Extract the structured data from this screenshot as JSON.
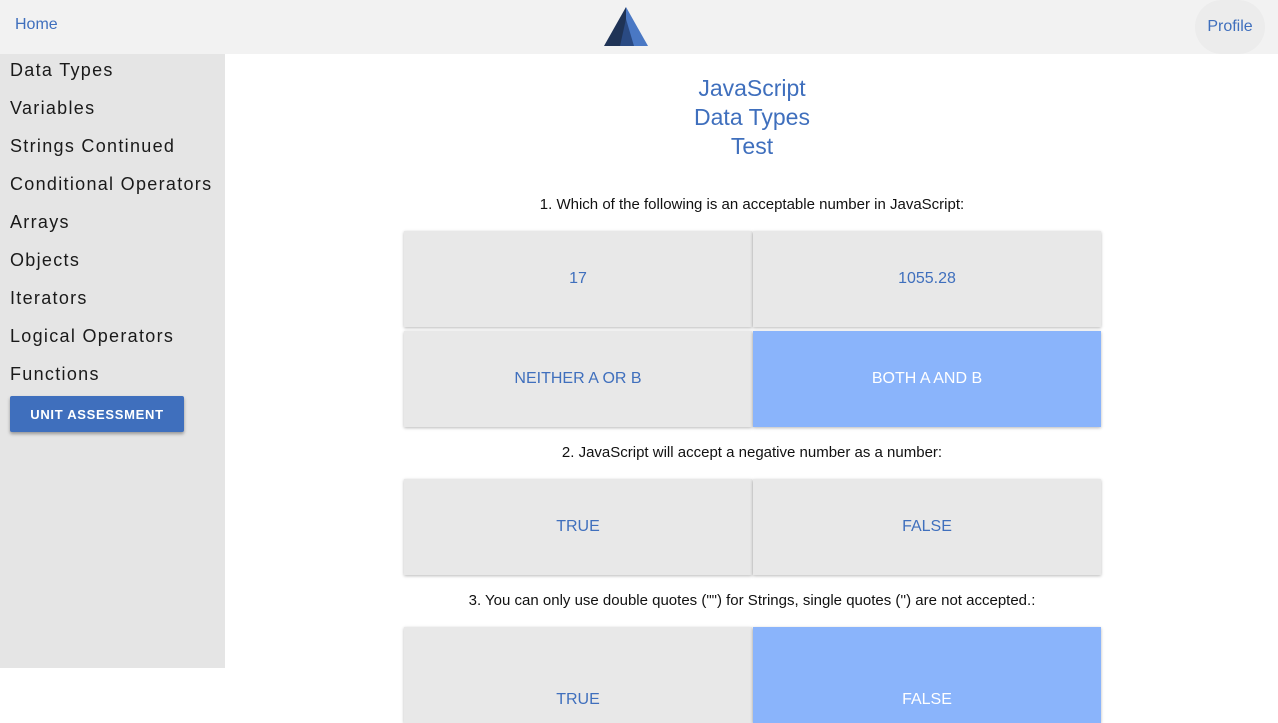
{
  "header": {
    "home_label": "Home",
    "profile_label": "Profile",
    "logo_icon": "mountain-logo-icon",
    "logo_colors": {
      "dark": "#1f3356",
      "light": "#4a78c4"
    }
  },
  "sidebar": {
    "items": [
      {
        "label": "Data Types"
      },
      {
        "label": "Variables"
      },
      {
        "label": "Strings Continued"
      },
      {
        "label": "Conditional Operators"
      },
      {
        "label": "Arrays"
      },
      {
        "label": "Objects"
      },
      {
        "label": "Iterators"
      },
      {
        "label": "Logical Operators"
      },
      {
        "label": "Functions"
      }
    ],
    "unit_assessment_label": "UNIT ASSESSMENT"
  },
  "main": {
    "title_lines": [
      "JavaScript",
      "Data Types",
      "Test"
    ],
    "questions": [
      {
        "text": "1. Which of the following is an acceptable number in JavaScript:",
        "answers": [
          {
            "label": "17",
            "selected": false
          },
          {
            "label": "1055.28",
            "selected": false
          },
          {
            "label": "NEITHER A OR B",
            "selected": false
          },
          {
            "label": "BOTH A AND B",
            "selected": true
          }
        ]
      },
      {
        "text": "2. JavaScript will accept a negative number as a number:",
        "answers": [
          {
            "label": "TRUE",
            "selected": false
          },
          {
            "label": "FALSE",
            "selected": false
          }
        ]
      },
      {
        "text": "3. You can only use double quotes (\"\") for Strings, single quotes ('') are not accepted.:",
        "answers": [
          {
            "label": "TRUE",
            "selected": false
          },
          {
            "label": "FALSE",
            "selected": true
          }
        ]
      }
    ]
  },
  "colors": {
    "accent": "#3f6fbd",
    "selected_answer": "#8ab4fb",
    "answer_bg": "#e8e8e8",
    "sidebar_bg": "#e5e5e5",
    "topbar_bg": "#f2f2f2"
  }
}
